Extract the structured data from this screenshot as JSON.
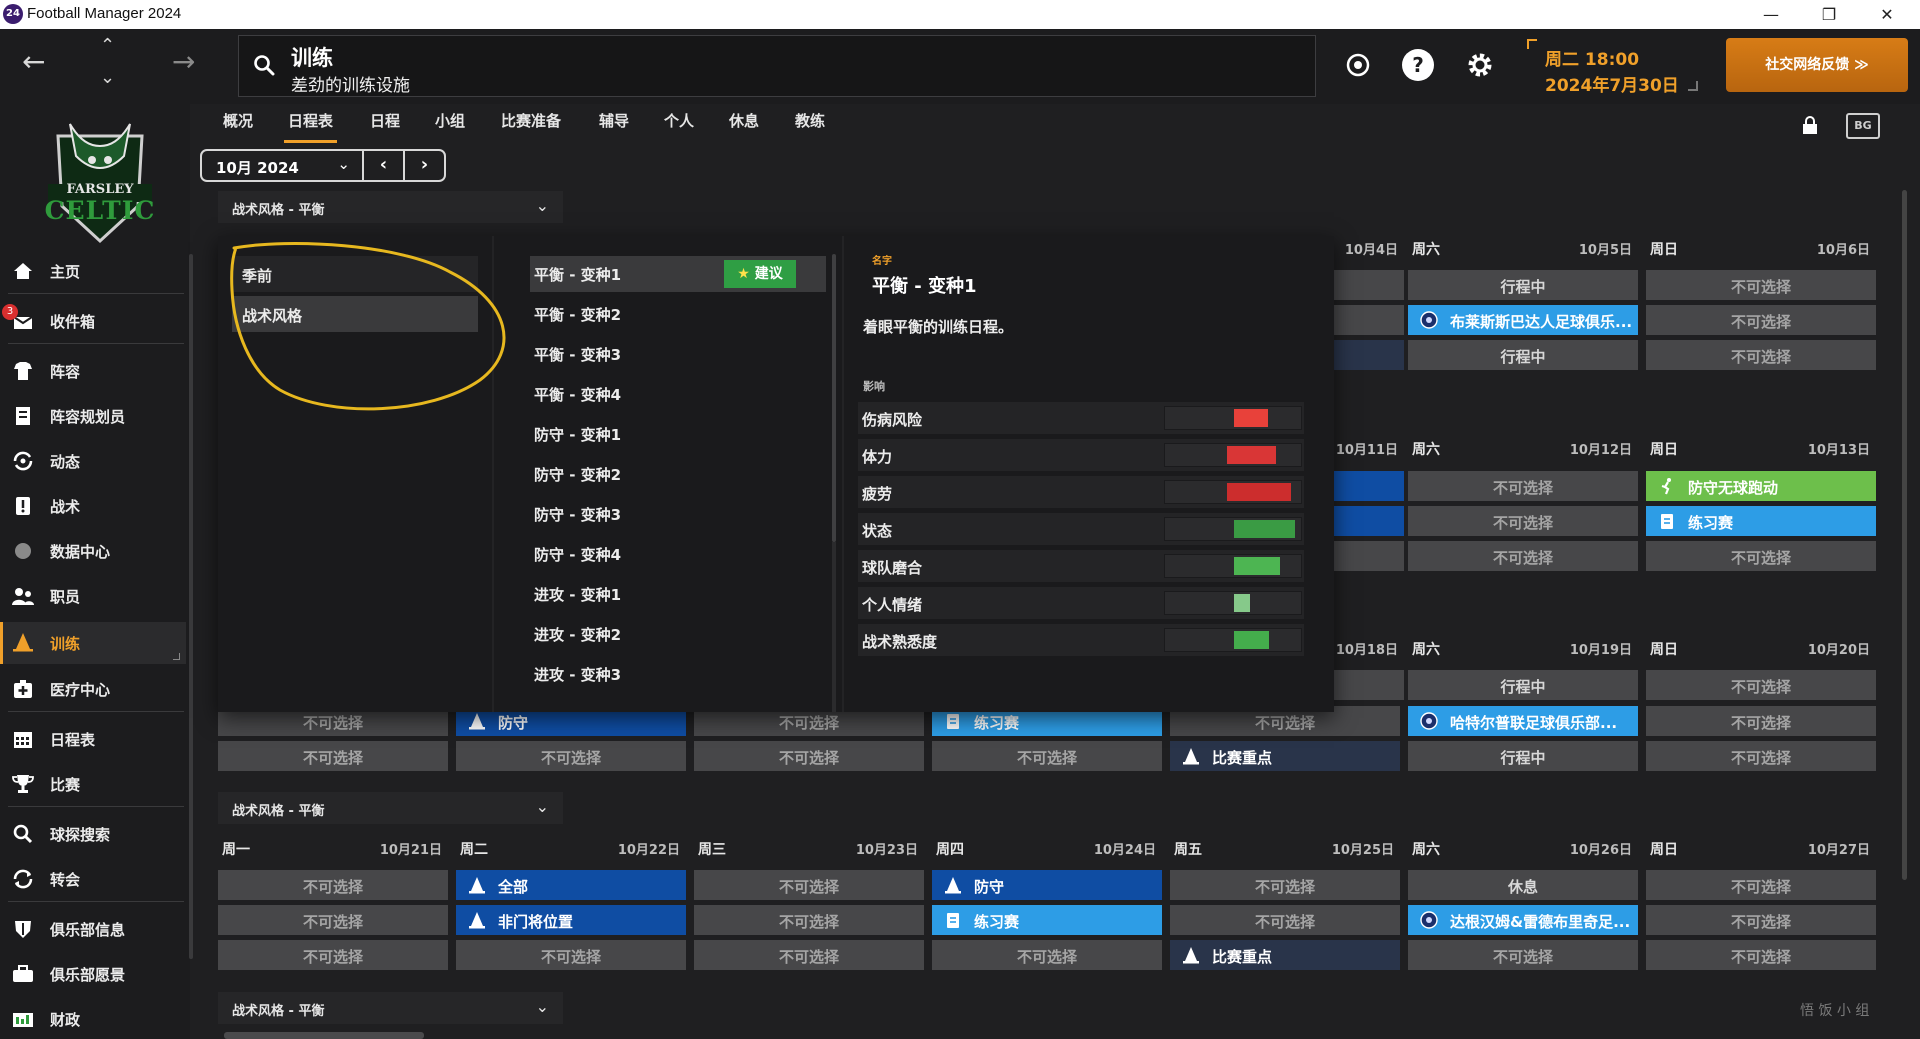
{
  "window": {
    "title": "Football Manager 2024",
    "icon_text": "24"
  },
  "topbar": {
    "search_title": "训练",
    "search_subtitle": "差劲的训练设施",
    "date_line1": "周二 18:00",
    "date_line2": "2024年7月30日",
    "feedback_label": "社交网络反馈 ≫"
  },
  "club": {
    "crest_line1": "FARSLEY",
    "crest_line2": "CELTIC"
  },
  "sidebar": {
    "items": [
      {
        "label": "主页",
        "icon": "home-icon"
      },
      {
        "label": "收件箱",
        "icon": "inbox-icon",
        "badge": "3"
      },
      {
        "label": "阵容",
        "icon": "squad-icon"
      },
      {
        "label": "阵容规划员",
        "icon": "planner-icon"
      },
      {
        "label": "动态",
        "icon": "dynamics-icon"
      },
      {
        "label": "战术",
        "icon": "tactics-icon"
      },
      {
        "label": "数据中心",
        "icon": "data-hub-icon"
      },
      {
        "label": "职员",
        "icon": "staff-icon"
      },
      {
        "label": "训练",
        "icon": "training-icon"
      },
      {
        "label": "医疗中心",
        "icon": "medical-icon"
      },
      {
        "label": "日程表",
        "icon": "calendar-icon"
      },
      {
        "label": "比赛",
        "icon": "trophy-icon"
      },
      {
        "label": "球探搜索",
        "icon": "scouting-icon"
      },
      {
        "label": "转会",
        "icon": "transfers-icon"
      },
      {
        "label": "俱乐部信息",
        "icon": "club-info-icon"
      },
      {
        "label": "俱乐部愿景",
        "icon": "club-vision-icon"
      },
      {
        "label": "财政",
        "icon": "finances-icon"
      }
    ]
  },
  "tabs": [
    "概况",
    "日程表",
    "日程",
    "小组",
    "比赛准备",
    "辅导",
    "个人",
    "休息",
    "教练"
  ],
  "month": {
    "label": "10月 2024",
    "prev": "‹",
    "next": "›"
  },
  "style_strip_label": "战术风格 - 平衡",
  "popup": {
    "categories": [
      "季前",
      "战术风格"
    ],
    "options": [
      "平衡 - 变种1",
      "平衡 - 变种2",
      "平衡 - 变种3",
      "平衡 - 变种4",
      "防守 - 变种1",
      "防守 - 变种2",
      "防守 - 变种3",
      "防守 - 变种4",
      "进攻 - 变种1",
      "进攻 - 变种2",
      "进攻 - 变种3"
    ],
    "recommend_label": "建议",
    "detail_name_label": "名字",
    "detail_name": "平衡 - 变种1",
    "detail_desc": "着眼平衡的训练日程。",
    "impact_label": "影响",
    "impacts": [
      {
        "label": "伤病风险",
        "color": "#e8413a",
        "from": 0.0,
        "to": 0.25
      },
      {
        "label": "体力",
        "color": "#d93636",
        "from": -0.05,
        "to": 0.31
      },
      {
        "label": "疲劳",
        "color": "#cc2d2d",
        "from": -0.05,
        "to": 0.42
      },
      {
        "label": "状态",
        "color": "#3a9b44",
        "from": 0.0,
        "to": 0.45
      },
      {
        "label": "球队磨合",
        "color": "#4db552",
        "from": 0.0,
        "to": 0.34
      },
      {
        "label": "个人情绪",
        "color": "#86c98a",
        "from": 0.0,
        "to": 0.12
      },
      {
        "label": "战术熟悉度",
        "color": "#44ad4c",
        "from": 0.0,
        "to": 0.26
      }
    ]
  },
  "weeks": [
    {
      "visible_days": [
        {
          "name": "",
          "date": "10月4日"
        },
        {
          "name": "周六",
          "date": "10月5日"
        },
        {
          "name": "周日",
          "date": "10月6日"
        }
      ],
      "cells": [
        [
          {
            "label": "",
            "style": "grey"
          },
          {
            "label": "行程中",
            "style": "grey-white"
          },
          {
            "label": "不可选择",
            "style": "grey"
          }
        ],
        [
          {
            "label": "",
            "style": "grey"
          },
          {
            "label": "布莱斯斯巴达人足球俱乐...",
            "style": "light",
            "icon": "club-badge-icon"
          },
          {
            "label": "不可选择",
            "style": "grey"
          }
        ],
        [
          {
            "label": "",
            "style": "navy"
          },
          {
            "label": "行程中",
            "style": "grey-white"
          },
          {
            "label": "不可选择",
            "style": "grey"
          }
        ]
      ]
    },
    {
      "visible_days": [
        {
          "name": "",
          "date": "10月11日"
        },
        {
          "name": "周六",
          "date": "10月12日"
        },
        {
          "name": "周日",
          "date": "10月13日"
        }
      ],
      "cells": [
        [
          {
            "label": "",
            "style": "blue"
          },
          {
            "label": "不可选择",
            "style": "grey"
          },
          {
            "label": "防守无球跑动",
            "style": "green",
            "icon": "running-icon"
          }
        ],
        [
          {
            "label": "",
            "style": "blue"
          },
          {
            "label": "不可选择",
            "style": "grey"
          },
          {
            "label": "练习赛",
            "style": "light",
            "icon": "clipboard-icon"
          }
        ],
        [
          {
            "label": "",
            "style": "grey"
          },
          {
            "label": "不可选择",
            "style": "grey"
          },
          {
            "label": "不可选择",
            "style": "grey"
          }
        ]
      ]
    },
    {
      "visible_days": [
        {
          "name": "",
          "date": "10月18日"
        },
        {
          "name": "周六",
          "date": "10月19日"
        },
        {
          "name": "周日",
          "date": "10月20日"
        }
      ],
      "cells_top": [
        [
          {
            "label": "",
            "style": "grey"
          },
          {
            "label": "行程中",
            "style": "grey-white"
          },
          {
            "label": "不可选择",
            "style": "grey"
          }
        ]
      ],
      "cells_full": [
        [
          {
            "label": "不可选择",
            "style": "grey"
          },
          {
            "label": "防守",
            "style": "blue",
            "icon": "cone-icon"
          },
          {
            "label": "不可选择",
            "style": "grey"
          },
          {
            "label": "练习赛",
            "style": "light",
            "icon": "clipboard-icon"
          },
          {
            "label": "不可选择",
            "style": "grey"
          },
          {
            "label": "哈特尔普联足球俱乐部...",
            "style": "light",
            "icon": "club-badge-icon"
          },
          {
            "label": "不可选择",
            "style": "grey"
          }
        ],
        [
          {
            "label": "不可选择",
            "style": "grey"
          },
          {
            "label": "不可选择",
            "style": "grey"
          },
          {
            "label": "不可选择",
            "style": "grey"
          },
          {
            "label": "不可选择",
            "style": "grey"
          },
          {
            "label": "比赛重点",
            "style": "navy",
            "icon": "cone-icon"
          },
          {
            "label": "行程中",
            "style": "grey-white"
          },
          {
            "label": "不可选择",
            "style": "grey"
          }
        ]
      ]
    },
    {
      "days": [
        {
          "name": "周一",
          "date": "10月21日"
        },
        {
          "name": "周二",
          "date": "10月22日"
        },
        {
          "name": "周三",
          "date": "10月23日"
        },
        {
          "name": "周四",
          "date": "10月24日"
        },
        {
          "name": "周五",
          "date": "10月25日"
        },
        {
          "name": "周六",
          "date": "10月26日"
        },
        {
          "name": "周日",
          "date": "10月27日"
        }
      ],
      "cells": [
        [
          {
            "label": "不可选择",
            "style": "grey"
          },
          {
            "label": "全部",
            "style": "blue",
            "icon": "cone-icon"
          },
          {
            "label": "不可选择",
            "style": "grey"
          },
          {
            "label": "防守",
            "style": "blue",
            "icon": "cone-icon"
          },
          {
            "label": "不可选择",
            "style": "grey"
          },
          {
            "label": "休息",
            "style": "grey-white"
          },
          {
            "label": "不可选择",
            "style": "grey"
          }
        ],
        [
          {
            "label": "不可选择",
            "style": "grey"
          },
          {
            "label": "非门将位置",
            "style": "blue",
            "icon": "cone-icon"
          },
          {
            "label": "不可选择",
            "style": "grey"
          },
          {
            "label": "练习赛",
            "style": "light",
            "icon": "clipboard-icon"
          },
          {
            "label": "不可选择",
            "style": "grey"
          },
          {
            "label": "达根汉姆&雷德布里奇足...",
            "style": "light",
            "icon": "club-badge-icon"
          },
          {
            "label": "不可选择",
            "style": "grey"
          }
        ],
        [
          {
            "label": "不可选择",
            "style": "grey"
          },
          {
            "label": "不可选择",
            "style": "grey"
          },
          {
            "label": "不可选择",
            "style": "grey"
          },
          {
            "label": "不可选择",
            "style": "grey"
          },
          {
            "label": "比赛重点",
            "style": "navy",
            "icon": "cone-icon"
          },
          {
            "label": "不可选择",
            "style": "grey"
          },
          {
            "label": "不可选择",
            "style": "grey"
          }
        ]
      ]
    }
  ],
  "watermark": "悟 饭 小 组"
}
